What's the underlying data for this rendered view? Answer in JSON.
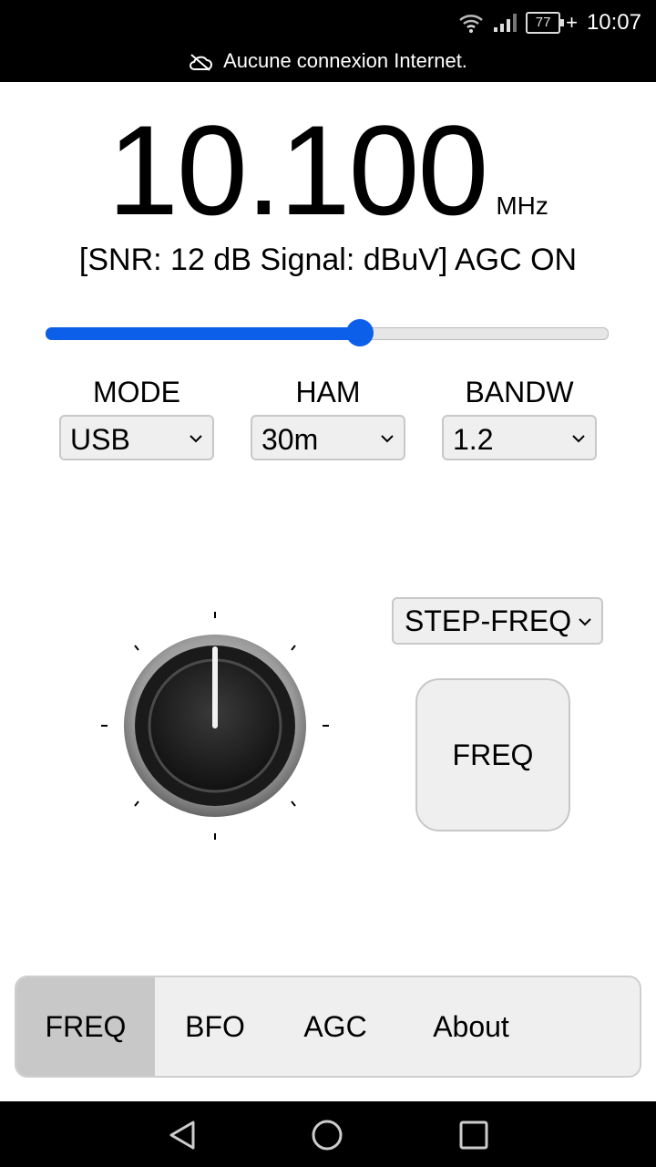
{
  "status_bar": {
    "time": "10:07",
    "battery": "77",
    "charging_mark": "+",
    "icons": [
      "wifi-icon",
      "cellular-signal-icon",
      "battery-icon"
    ],
    "offline_message": "Aucune connexion Internet."
  },
  "frequency": {
    "value": "10.100",
    "unit": "MHz"
  },
  "signal_line": "[SNR:  12 dB Signal:   dBuV] AGC ON",
  "tuning_slider": {
    "level": 0.56
  },
  "controls": {
    "mode": {
      "label": "MODE",
      "value": "USB"
    },
    "ham": {
      "label": "HAM",
      "value": "30m"
    },
    "bandw": {
      "label": "BANDW",
      "value": "1.2"
    },
    "step_select": {
      "value": "STEP-FREQ"
    },
    "action_button": {
      "label": "FREQ"
    }
  },
  "tabs": [
    {
      "label": "FREQ",
      "active": true
    },
    {
      "label": "BFO",
      "active": false
    },
    {
      "label": "AGC",
      "active": false
    },
    {
      "label": "About",
      "active": false
    }
  ],
  "colors": {
    "accent": "#0b5fe8",
    "active_tab": "#c8c8c8"
  }
}
